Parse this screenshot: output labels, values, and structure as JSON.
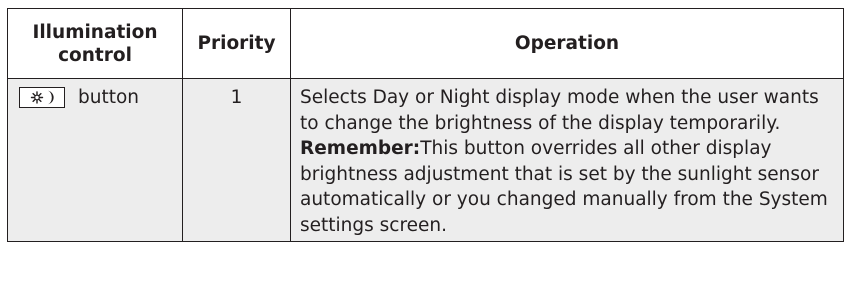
{
  "table": {
    "headers": {
      "control": "Illumination control",
      "priority": "Priority",
      "operation": "Operation"
    },
    "rows": [
      {
        "control_icon": "day-night-icon",
        "control_label": "button",
        "priority": "1",
        "operation": "Selects Day or Night display mode when the user wants to change the brightness of the display temporarily.",
        "remember_label": "Remember:",
        "remember_text": "This button overrides all other display brightness adjustment that is set by the sunlight sensor automatically or you changed manually from the System settings screen."
      }
    ]
  }
}
